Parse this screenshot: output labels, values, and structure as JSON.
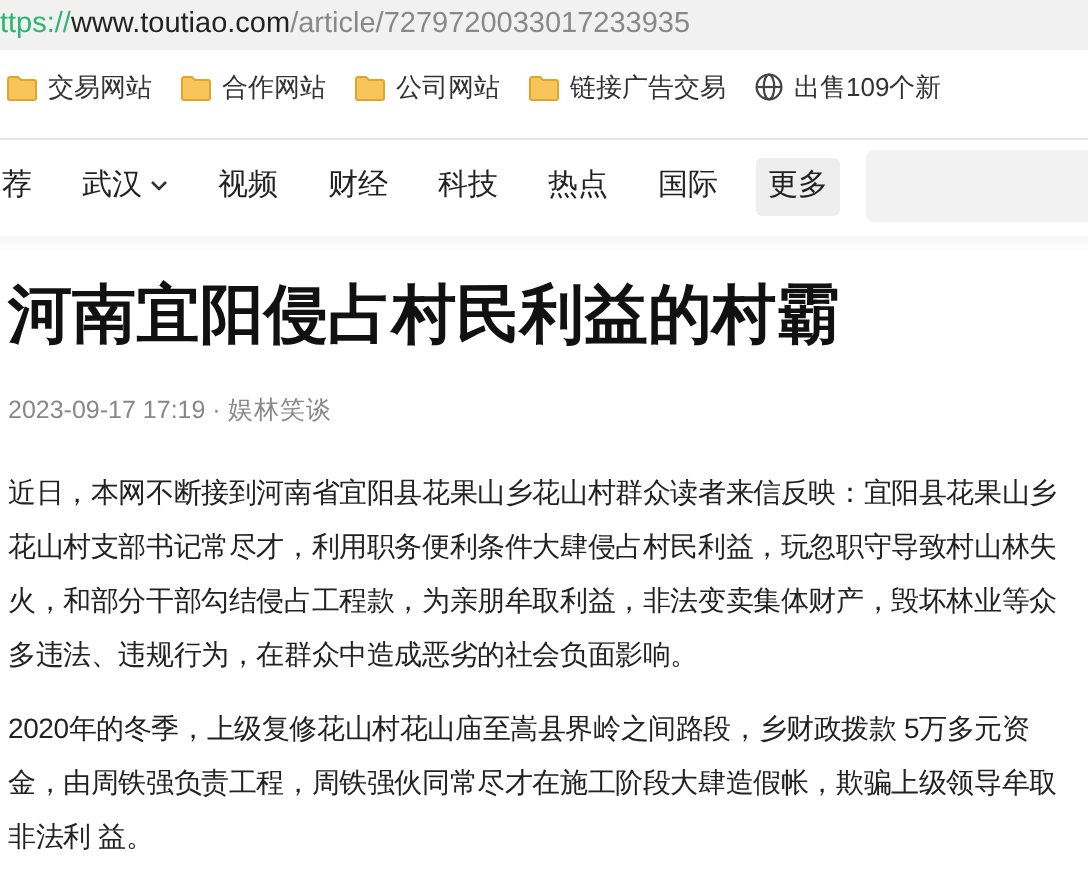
{
  "address_bar": {
    "scheme": "ttps://",
    "host": "www.toutiao.com",
    "path": "/article/7279720033017233935"
  },
  "bookmarks": [
    {
      "kind": "folder",
      "label": "交易网站"
    },
    {
      "kind": "folder",
      "label": "合作网站"
    },
    {
      "kind": "folder",
      "label": "公司网站"
    },
    {
      "kind": "folder",
      "label": "链接广告交易"
    },
    {
      "kind": "site",
      "label": "出售109个新"
    }
  ],
  "channels": [
    {
      "label": "荐",
      "dropdown": false,
      "selected": false
    },
    {
      "label": "武汉",
      "dropdown": true,
      "selected": false
    },
    {
      "label": "视频",
      "dropdown": false,
      "selected": false
    },
    {
      "label": "财经",
      "dropdown": false,
      "selected": false
    },
    {
      "label": "科技",
      "dropdown": false,
      "selected": false
    },
    {
      "label": "热点",
      "dropdown": false,
      "selected": false
    },
    {
      "label": "国际",
      "dropdown": false,
      "selected": false
    },
    {
      "label": "更多",
      "dropdown": false,
      "selected": true
    }
  ],
  "article": {
    "title": "河南宜阳侵占村民利益的村霸",
    "meta": "2023-09-17 17:19 · 娱林笑谈",
    "paragraphs": [
      "近日，本网不断接到河南省宜阳县花果山乡花山村群众读者来信反映：宜阳县花果山乡花山村支部书记常尽才，利用职务便利条件大肆侵占村民利益，玩忽职守导致村山林失火，和部分干部勾结侵占工程款，为亲朋牟取利益，非法变卖集体财产，毁坏林业等众多违法、违规行为，在群众中造成恶劣的社会负面影响。",
      "2020年的冬季，上级复修花山村花山庙至嵩县界岭之间路段，乡财政拨款 5万多元资金，由周铁强负责工程，周铁强伙同常尽才在施工阶段大肆造假帐，欺骗上级领导牟取非法利 益。"
    ]
  }
}
